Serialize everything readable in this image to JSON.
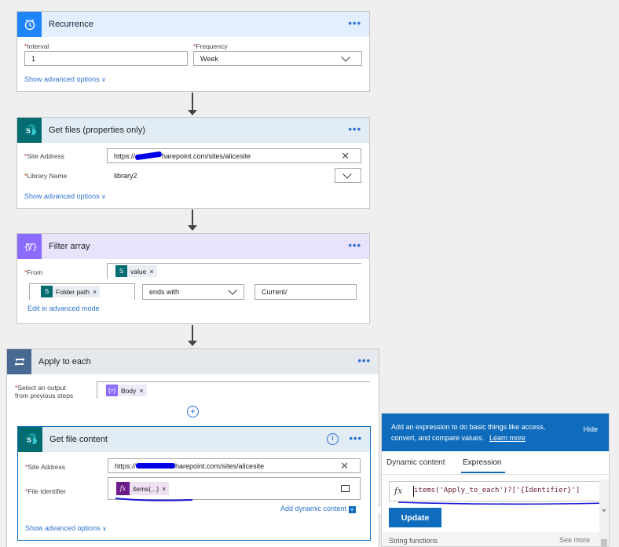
{
  "recurrence": {
    "title": "Recurrence",
    "interval_label": "Interval",
    "interval_value": "1",
    "frequency_label": "Frequency",
    "frequency_value": "Week",
    "advanced_link": "Show advanced options"
  },
  "get_files": {
    "title": "Get files (properties only)",
    "site_label": "Site Address",
    "site_value_prefix": "https://",
    "site_value_suffix": "harepoint.com/sites/alicesite",
    "library_label": "Library Name",
    "library_value": "library2",
    "advanced_link": "Show advanced options"
  },
  "filter_array": {
    "title": "Filter array",
    "from_label": "From",
    "from_token": "value",
    "folder_token": "Folder path",
    "operator_value": "ends with",
    "compare_value": "Current/",
    "advanced_link": "Edit in advanced mode"
  },
  "apply_each": {
    "title": "Apply to each",
    "select_label_1": "Select an output",
    "select_label_2": "from previous steps",
    "body_token": "Body"
  },
  "get_file_content": {
    "title": "Get file content",
    "site_label": "Site Address",
    "site_value_prefix": "https://",
    "site_value_suffix": "harepoint.com/sites/alicesite",
    "file_id_label": "File Identifier",
    "file_id_token": "items(...)",
    "add_dynamic": "Add dynamic content",
    "advanced_link": "Show advanced options"
  },
  "expr_panel": {
    "info_text": "Add an expression to do basic things like access, convert, and compare values.",
    "learn_more": "Learn more",
    "hide": "Hide",
    "tab_dynamic": "Dynamic content",
    "tab_expression": "Expression",
    "fx": "fx",
    "expression": "items('Apply_to_each')?['{Identifier}']",
    "update_button": "Update",
    "section_label": "String functions",
    "see_more": "See more"
  },
  "icons": {
    "dots": "more-options-icon",
    "clock": "clock-icon",
    "sharepoint": "sharepoint-icon",
    "filter": "filter-icon",
    "loop": "loop-icon",
    "add": "plus-circle-icon",
    "info": "info-icon",
    "folder": "folder-icon"
  },
  "colors": {
    "recurrence": "#1f85ff",
    "recurrence_bg": "#e1efff",
    "sharepoint": "#036c70",
    "sharepoint_bg": "#e2ecf5",
    "filter": "#8c6cff",
    "filter_bg": "#e8e2fb",
    "loop": "#486991",
    "loop_bg": "#e5e8ec",
    "accent": "#0f6cbd",
    "expression": "#6b1a8a",
    "annotation": "#1a1ad8"
  }
}
